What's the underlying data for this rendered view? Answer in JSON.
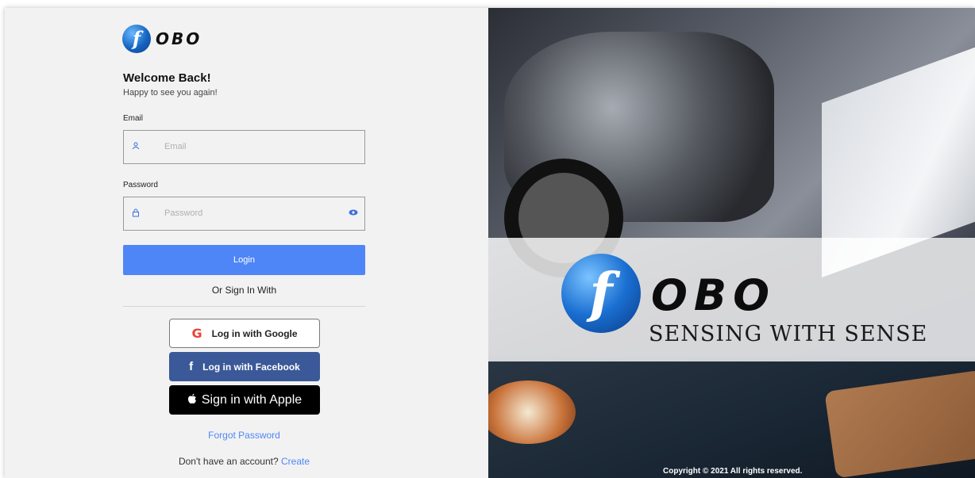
{
  "brand": {
    "logo_text": "OBO",
    "logo_letter": "f",
    "tagline": "SENSING WITH SENSE",
    "color": "#1565c0"
  },
  "form": {
    "welcome_title": "Welcome Back!",
    "welcome_subtitle": "Happy to see you again!",
    "email_label": "Email",
    "email_placeholder": "Email",
    "email_icon": "user-icon",
    "password_label": "Password",
    "password_placeholder": "Password",
    "password_icon": "lock-icon",
    "password_toggle_icon": "eye-icon",
    "login_button": "Login",
    "login_color": "#4f86f7",
    "or_text": "Or Sign In With",
    "forgot_password": "Forgot Password",
    "signup_prompt": "Don't have an account?",
    "signup_link": "Create"
  },
  "social": {
    "google": {
      "label": "Log in with Google",
      "icon": "G"
    },
    "facebook": {
      "label": "Log in with Facebook",
      "icon": "f",
      "color": "#3b5998"
    },
    "apple": {
      "label": "Sign in with Apple",
      "icon": "apple-icon",
      "color": "#000000"
    }
  },
  "footer": {
    "copyright": "Copyright © 2021 All rights reserved."
  }
}
